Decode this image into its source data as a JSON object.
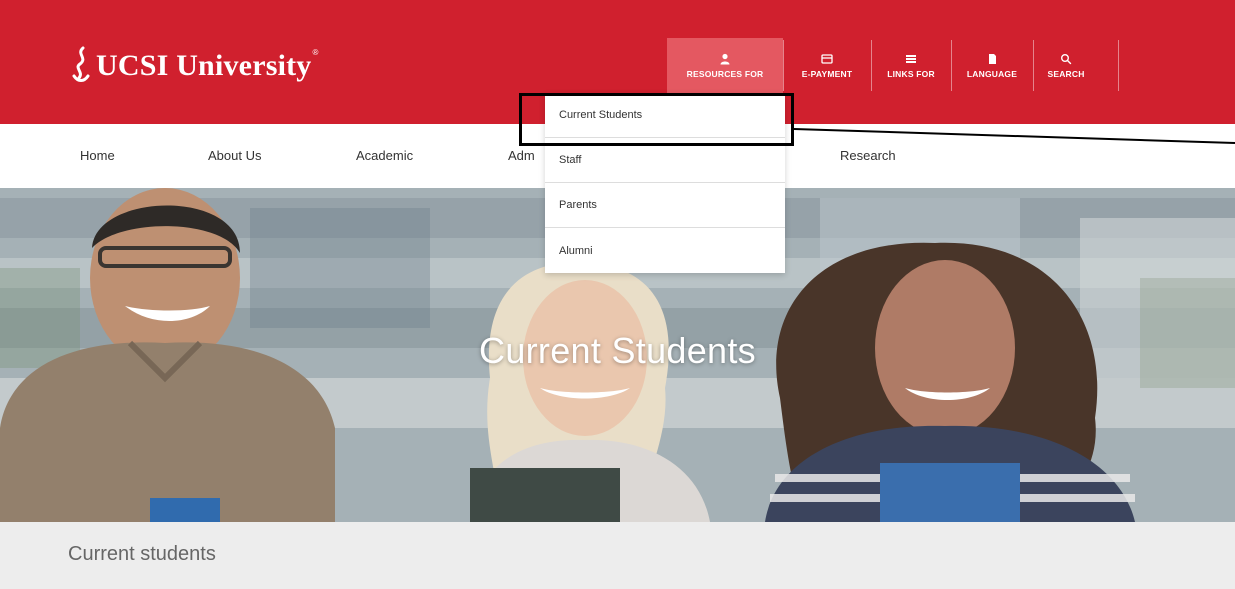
{
  "brand": {
    "name": "UCSI University",
    "reg": "®"
  },
  "utility_nav": [
    {
      "label": "RESOURCES FOR",
      "icon": "user-icon"
    },
    {
      "label": "E-PAYMENT",
      "icon": "credit-card-icon"
    },
    {
      "label": "LINKS FOR",
      "icon": "list-icon"
    },
    {
      "label": "LANGUAGE",
      "icon": "document-icon"
    },
    {
      "label": "SEARCH",
      "icon": "search-icon"
    }
  ],
  "main_nav": [
    "Home",
    "About Us",
    "Academic",
    "Adm",
    "Research"
  ],
  "dropdown": {
    "items": [
      "Current Students",
      "Staff",
      "Parents",
      "Alumni"
    ]
  },
  "hero": {
    "title": "Current Students"
  },
  "page": {
    "title": "Current students"
  },
  "colors": {
    "brand_red": "#d0202e",
    "active_tab": "#e45861",
    "strip_bg": "#ededed"
  }
}
